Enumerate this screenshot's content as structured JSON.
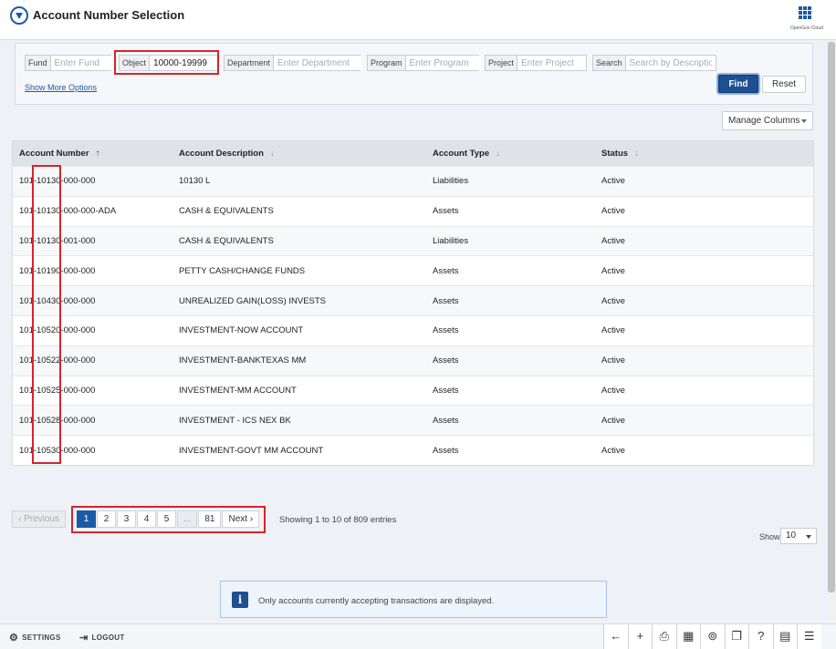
{
  "header": {
    "title": "Account Number Selection",
    "brand": "OpenGov Cloud"
  },
  "filters": {
    "fund": {
      "label": "Fund",
      "placeholder": "Enter Fund",
      "value": ""
    },
    "object": {
      "label": "Object",
      "placeholder": "",
      "value": "10000-19999"
    },
    "department": {
      "label": "Department",
      "placeholder": "Enter Department",
      "value": ""
    },
    "program": {
      "label": "Program",
      "placeholder": "Enter Program",
      "value": ""
    },
    "project": {
      "label": "Project",
      "placeholder": "Enter Project",
      "value": ""
    },
    "search": {
      "label": "Search",
      "placeholder": "Search by Description",
      "value": ""
    },
    "show_more": "Show More Options",
    "find": "Find",
    "reset": "Reset"
  },
  "manage_columns": "Manage Columns",
  "table": {
    "columns": [
      "Account Number",
      "Account Description",
      "Account  Type",
      "Status"
    ],
    "rows": [
      [
        "101-10130-000-000",
        "10130 L",
        "Liabilities",
        "Active"
      ],
      [
        "101-10130-000-000-ADA",
        "CASH & EQUIVALENTS",
        "Assets",
        "Active"
      ],
      [
        "101-10130-001-000",
        "CASH & EQUIVALENTS",
        "Liabilities",
        "Active"
      ],
      [
        "101-10190-000-000",
        "PETTY CASH/CHANGE FUNDS",
        "Assets",
        "Active"
      ],
      [
        "101-10430-000-000",
        "UNREALIZED GAIN(LOSS) INVESTS",
        "Assets",
        "Active"
      ],
      [
        "101-10520-000-000",
        "INVESTMENT-NOW ACCOUNT",
        "Assets",
        "Active"
      ],
      [
        "101-10522-000-000",
        "INVESTMENT-BANKTEXAS MM",
        "Assets",
        "Active"
      ],
      [
        "101-10525-000-000",
        "INVESTMENT-MM ACCOUNT",
        "Assets",
        "Active"
      ],
      [
        "101-10528-000-000",
        "INVESTMENT - ICS NEX BK",
        "Assets",
        "Active"
      ],
      [
        "101-10530-000-000",
        "INVESTMENT-GOVT MM ACCOUNT",
        "Assets",
        "Active"
      ]
    ]
  },
  "pagination": {
    "previous": "‹ Previous",
    "pages": [
      "1",
      "2",
      "3",
      "4",
      "5",
      "...",
      "81"
    ],
    "active_page": "1",
    "next": "Next ›",
    "entries": "Showing 1 to 10 of 809 entries",
    "show_label": "Show",
    "show_value": "10"
  },
  "info": {
    "icon": "info-icon",
    "text": "Only accounts currently accepting transactions are displayed."
  },
  "bottom_bar": {
    "settings": "SETTINGS",
    "logout": "LOGOUT",
    "tools": [
      "back-arrow-icon",
      "plus-icon",
      "print-icon",
      "grid-view-icon",
      "binoculars-icon",
      "copy-icon",
      "help-icon",
      "calendar-icon",
      "hierarchy-icon"
    ]
  },
  "colors": {
    "accent": "#1b5aa8",
    "highlight": "#d9232e"
  }
}
